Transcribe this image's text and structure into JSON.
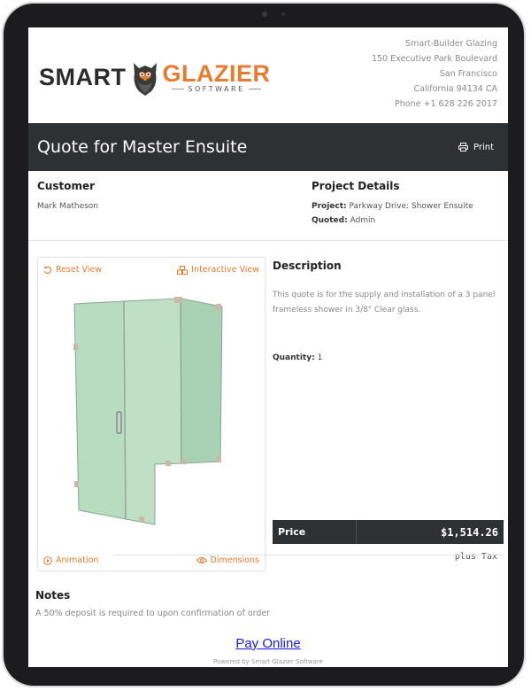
{
  "logo": {
    "word1": "SMART",
    "word2": "GLAZIER",
    "tagline": "SOFTWARE"
  },
  "company": {
    "name": "Smart-Builder Glazing",
    "street": "150 Executive Park Boulevard",
    "city": "San Francisco",
    "state_zip": "California 94134 CA",
    "phone": "Phone +1 628 226 2017"
  },
  "titlebar": {
    "title": "Quote for Master Ensuite",
    "print_label": "Print"
  },
  "customer": {
    "heading": "Customer",
    "name": "Mark Matheson"
  },
  "project": {
    "heading": "Project Details",
    "project_label": "Project:",
    "project_value": "Parkway Drive: Shower Ensuite",
    "quoted_label": "Quoted:",
    "quoted_value": "Admin"
  },
  "viewer": {
    "reset_label": "Reset View",
    "interactive_label": "Interactive View",
    "animation_label": "Animation",
    "dimensions_label": "Dimensions"
  },
  "description": {
    "heading": "Description",
    "text": "This quote is for the supply and installation of a 3 panel frameless shower in 3/8\" Clear glass.",
    "quantity_label": "Quantity:",
    "quantity_value": "1"
  },
  "price": {
    "label": "Price",
    "value": "$1,514.26",
    "tax_note": "plus Tax"
  },
  "notes": {
    "heading": "Notes",
    "text": "A 50% deposit is required to upon confirmation of order"
  },
  "footer": {
    "pay_label": "Pay Online",
    "powered": "Powered by Smart Glazier Software"
  },
  "colors": {
    "accent": "#e87b2e",
    "dark_bar": "#2e3133",
    "glass": "#b8dcc0"
  }
}
